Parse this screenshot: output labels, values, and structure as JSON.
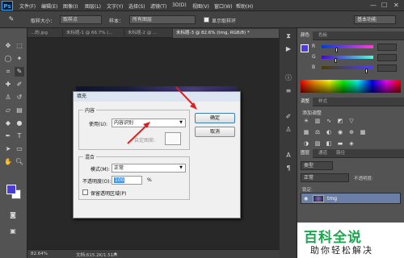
{
  "app": {
    "logo": "Ps"
  },
  "menu": [
    "文件(F)",
    "编辑(E)",
    "图像(I)",
    "图层(L)",
    "文字(Y)",
    "选择(S)",
    "滤镜(T)",
    "3D(D)",
    "视图(V)",
    "窗口(W)",
    "帮助(H)"
  ],
  "window_controls": {
    "minimize": "—",
    "maximize": "☐",
    "close": "✕"
  },
  "options": {
    "sample_size_label": "取样大小：",
    "sample_size_value": "取样点",
    "sample_label": "样本：",
    "sample_value": "所有图层",
    "show_ring_label": "显示取样环",
    "workspace": "基本功能"
  },
  "tabs": [
    "...的.jpg",
    "未标题-1 @ 66.7% (...",
    "未标题-2 @ ...",
    "未标题-3 @ 82.6% (tmg, RGB/8) *"
  ],
  "status": {
    "zoom": "82.64%",
    "doc": "文档:615.2K/1.51M"
  },
  "dialog": {
    "title": "填充",
    "contents_group": "内容",
    "use_label": "使用(U):",
    "use_value": "内容识别",
    "custom_pattern_label": "自定图案:",
    "blending_group": "混合",
    "mode_label": "模式(M):",
    "mode_value": "正常",
    "opacity_label": "不透明度(O):",
    "opacity_value": "100",
    "opacity_unit": "%",
    "preserve_label": "保留透明区域(P)",
    "ok_label": "确定",
    "cancel_label": "取消"
  },
  "panels": {
    "color_tabs": [
      "颜色",
      "色板"
    ],
    "sliders": [
      {
        "letter": "R",
        "value": ""
      },
      {
        "letter": "G",
        "value": ""
      },
      {
        "letter": "B",
        "value": ""
      }
    ],
    "adjust_tabs": [
      "调整",
      "样式"
    ],
    "adjust_hint": "添加调整",
    "layers_tabs": [
      "图层",
      "通道",
      "路径"
    ],
    "layer_kind": "类型",
    "blend_mode": "正常",
    "opacity_label": "不透明度:",
    "lock_label": "锁定:",
    "layer_name": "tmg"
  },
  "colors": {
    "foreground": "#4a3ddb",
    "background": "#ffffff",
    "accent": "#31a8ff"
  },
  "watermark": {
    "line1": "百科全说",
    "line2": "助你轻松解决"
  }
}
